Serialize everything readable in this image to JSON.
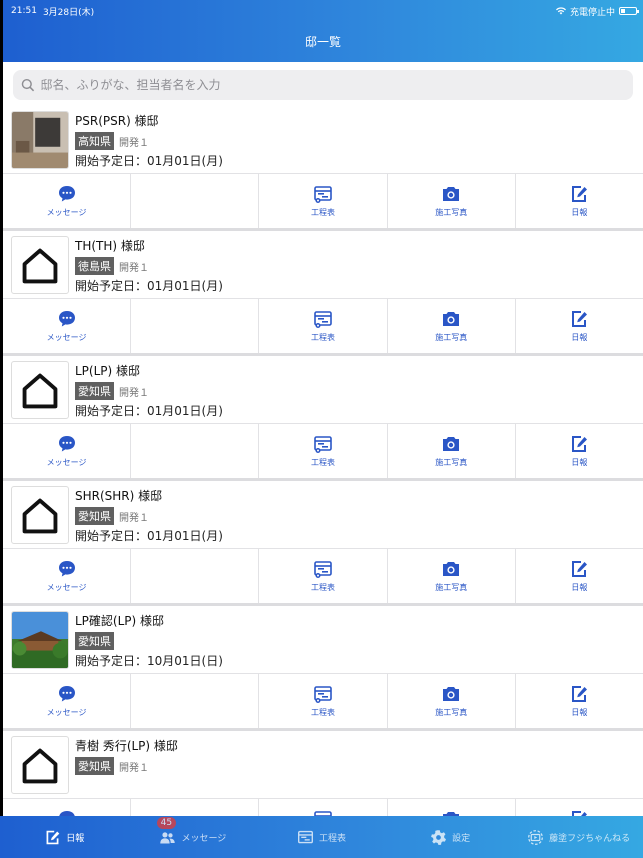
{
  "status": {
    "time": "21:51",
    "date": "3月28日(木)",
    "charge": "充電停止中"
  },
  "header": {
    "title": "邸一覧"
  },
  "search": {
    "placeholder": "邸名、ふりがな、担当者名を入力"
  },
  "actions": {
    "message": "メッセージ",
    "schedule": "工程表",
    "photo": "施工写真",
    "report": "日報"
  },
  "houses": [
    {
      "name": "PSR(PSR) 様邸",
      "prefecture": "高知県",
      "dev": "開発１",
      "start": "開始予定日：01月01日(月)",
      "thumb": "room-photo"
    },
    {
      "name": "TH(TH) 様邸",
      "prefecture": "徳島県",
      "dev": "開発１",
      "start": "開始予定日：01月01日(月)",
      "thumb": "house-icon"
    },
    {
      "name": "LP(LP) 様邸",
      "prefecture": "愛知県",
      "dev": "開発１",
      "start": "開始予定日：01月01日(月)",
      "thumb": "house-icon"
    },
    {
      "name": "SHR(SHR) 様邸",
      "prefecture": "愛知県",
      "dev": "開発１",
      "start": "開始予定日：01月01日(月)",
      "thumb": "house-icon"
    },
    {
      "name": "LP確認(LP) 様邸",
      "prefecture": "愛知県",
      "dev": "",
      "start": "開始予定日：10月01日(日)",
      "thumb": "temple-photo"
    },
    {
      "name": "青樹 秀行(LP) 様邸",
      "prefecture": "愛知県",
      "dev": "開発１",
      "start": "",
      "thumb": "house-icon"
    }
  ],
  "tabbar": {
    "items": [
      {
        "label": "日報"
      },
      {
        "label": "メッセージ",
        "badge": "45"
      },
      {
        "label": "工程表"
      },
      {
        "label": "設定"
      },
      {
        "label": "藤塗フジちゃんねる"
      }
    ]
  },
  "colors": {
    "accent": "#2a56c6",
    "header_start": "#1e5fd0",
    "header_end": "#35a8e2",
    "badge": "#e53935"
  }
}
